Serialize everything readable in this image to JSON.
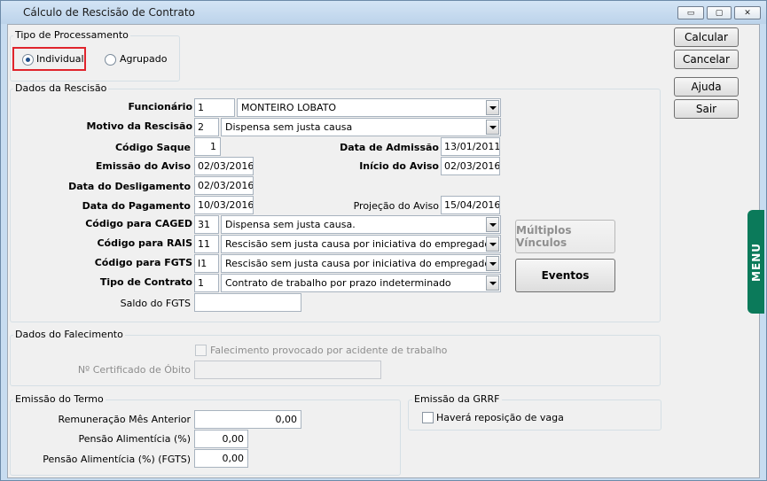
{
  "window": {
    "title": "Cálculo de Rescisão de Contrato",
    "min_glyph": "▭",
    "max_glyph": "▢",
    "close_glyph": "✕"
  },
  "processamento": {
    "legend": "Tipo de Processamento",
    "individual": "Individual",
    "agrupado": "Agrupado",
    "selected": "Individual"
  },
  "rescisao": {
    "legend": "Dados da Rescisão",
    "funcionario_label": "Funcionário",
    "funcionario_code": "1",
    "funcionario_name": "MONTEIRO LOBATO",
    "motivo_label": "Motivo da Rescisão",
    "motivo_code": "2",
    "motivo_desc": "Dispensa sem justa causa",
    "codigo_saque_label": "Código Saque",
    "codigo_saque": "1",
    "data_admissao_label": "Data de Admissão",
    "data_admissao": "13/01/2011",
    "emissao_aviso_label": "Emissão do Aviso",
    "emissao_aviso": "02/03/2016",
    "inicio_aviso_label": "Início do Aviso",
    "inicio_aviso": "02/03/2016",
    "data_desligamento_label": "Data do Desligamento",
    "data_desligamento": "02/03/2016",
    "data_pagamento_label": "Data do Pagamento",
    "data_pagamento": "10/03/2016",
    "projecao_aviso_label": "Projeção do Aviso",
    "projecao_aviso": "15/04/2016",
    "caged_label": "Código para CAGED",
    "caged_code": "31",
    "caged_desc": "Dispensa sem justa causa.",
    "rais_label": "Código para RAIS",
    "rais_code": "11",
    "rais_desc": "Rescisão sem justa causa por iniciativa do empregador.",
    "fgts_label": "Código para FGTS",
    "fgts_code": "I1",
    "fgts_desc": "Rescisão sem justa causa por iniciativa do empregador.",
    "tipo_contrato_label": "Tipo de Contrato",
    "tipo_contrato_code": "1",
    "tipo_contrato_desc": "Contrato de trabalho por prazo indeterminado",
    "saldo_fgts_label": "Saldo do FGTS",
    "saldo_fgts": "",
    "multiplos_vinculos": "Múltiplos Vínculos",
    "eventos": "Eventos"
  },
  "falecimento": {
    "legend": "Dados do Falecimento",
    "acidente_label": "Falecimento provocado por acidente de trabalho",
    "certificado_label": "Nº Certificado de Óbito",
    "certificado": ""
  },
  "termo": {
    "legend": "Emissão do Termo",
    "remuneracao_label": "Remuneração Mês Anterior",
    "remuneracao": "0,00",
    "pensao_label": "Pensão Alimentícia (%)",
    "pensao": "0,00",
    "pensao_fgts_label": "Pensão Alimentícia (%) (FGTS)",
    "pensao_fgts": "0,00"
  },
  "grrf": {
    "legend": "Emissão da GRRF",
    "reposicao_label": "Haverá reposição de vaga"
  },
  "actions": {
    "calcular": "Calcular",
    "cancelar": "Cancelar",
    "ajuda": "Ajuda",
    "sair": "Sair"
  },
  "side_tab": {
    "label": "MENU"
  },
  "colors": {
    "highlight": "#e0242c",
    "menu_tab": "#0b7a5a"
  }
}
